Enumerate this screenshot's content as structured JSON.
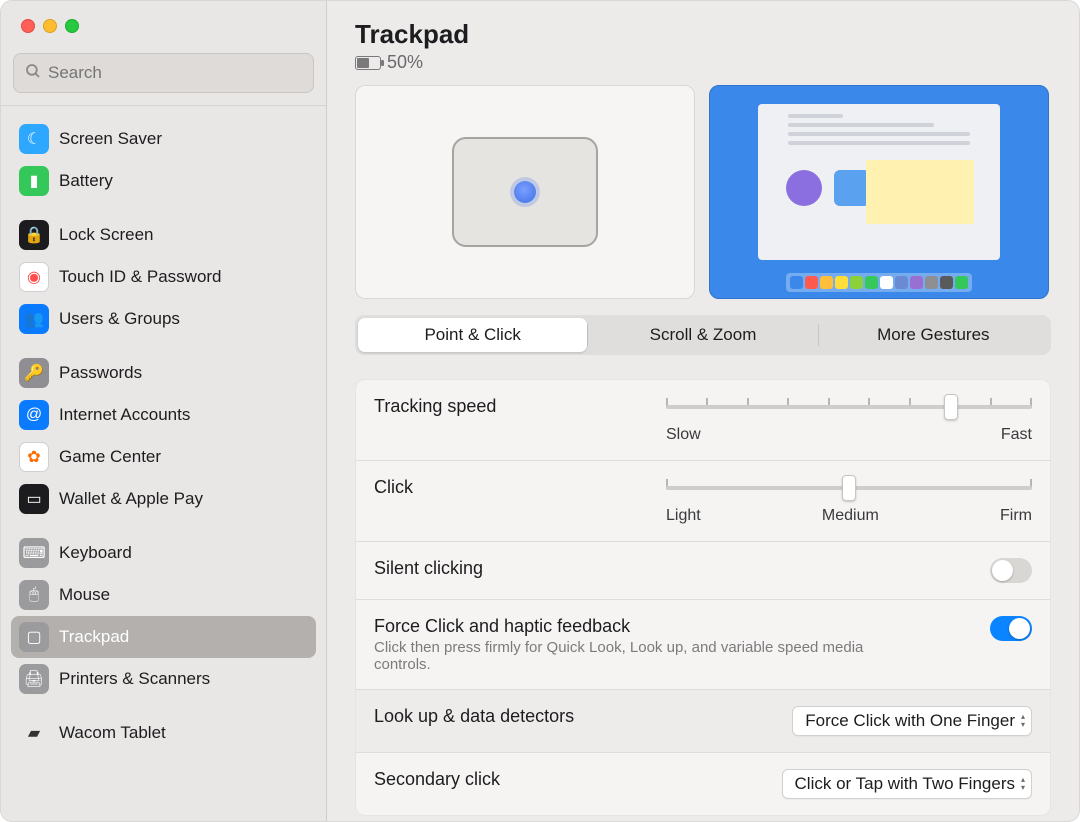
{
  "search": {
    "placeholder": "Search"
  },
  "sidebar": {
    "groups": [
      {
        "items": [
          {
            "label": "Screen Saver",
            "ico_bg": "#2ea7ff",
            "glyph": "☾"
          },
          {
            "label": "Battery",
            "ico_bg": "#34c759",
            "glyph": "▮"
          }
        ]
      },
      {
        "items": [
          {
            "label": "Lock Screen",
            "ico_bg": "#1c1c1e",
            "glyph": "🔒"
          },
          {
            "label": "Touch ID & Password",
            "ico_bg": "#ffffff",
            "glyph": "◉",
            "fg": "#ff4d4d"
          },
          {
            "label": "Users & Groups",
            "ico_bg": "#0a7bff",
            "glyph": "👥"
          }
        ]
      },
      {
        "items": [
          {
            "label": "Passwords",
            "ico_bg": "#8e8e93",
            "glyph": "🔑"
          },
          {
            "label": "Internet Accounts",
            "ico_bg": "#0a7bff",
            "glyph": "@"
          },
          {
            "label": "Game Center",
            "ico_bg": "#ffffff",
            "glyph": "✿",
            "fg": "#ff6a00"
          },
          {
            "label": "Wallet & Apple Pay",
            "ico_bg": "#1c1c1e",
            "glyph": "▭"
          }
        ]
      },
      {
        "items": [
          {
            "label": "Keyboard",
            "ico_bg": "#9b9b9e",
            "glyph": "⌨"
          },
          {
            "label": "Mouse",
            "ico_bg": "#9b9b9e",
            "glyph": "🖱"
          },
          {
            "label": "Trackpad",
            "ico_bg": "#9b9b9e",
            "glyph": "▢",
            "selected": true
          },
          {
            "label": "Printers & Scanners",
            "ico_bg": "#9b9b9e",
            "glyph": "🖨"
          }
        ]
      },
      {
        "items": [
          {
            "label": "Wacom Tablet",
            "ico_bg": "transparent",
            "glyph": "▰",
            "fg": "#333"
          }
        ]
      }
    ]
  },
  "header": {
    "title": "Trackpad",
    "battery": "50%"
  },
  "tabs": [
    "Point & Click",
    "Scroll & Zoom",
    "More Gestures"
  ],
  "tab_active": 0,
  "settings": {
    "tracking": {
      "label": "Tracking speed",
      "min_label": "Slow",
      "max_label": "Fast",
      "ticks": 10,
      "value_index": 7
    },
    "click": {
      "label": "Click",
      "labels": [
        "Light",
        "Medium",
        "Firm"
      ],
      "value_index": 1
    },
    "silent": {
      "label": "Silent clicking",
      "on": false
    },
    "force": {
      "label": "Force Click and haptic feedback",
      "desc": "Click then press firmly for Quick Look, Look up, and variable speed media controls.",
      "on": true
    },
    "lookup": {
      "label": "Look up & data detectors",
      "value": "Force Click with One Finger"
    },
    "secondary": {
      "label": "Secondary click",
      "value": "Click or Tap with Two Fingers"
    }
  },
  "dock_colors": [
    "#3a88e9",
    "#ff5a4d",
    "#ffbf3a",
    "#ffde3a",
    "#8bd23a",
    "#37c85b",
    "#ffffff",
    "#6a8bd4",
    "#9a6fd4",
    "#8e8e93",
    "#5a5a5c",
    "#34c759"
  ]
}
